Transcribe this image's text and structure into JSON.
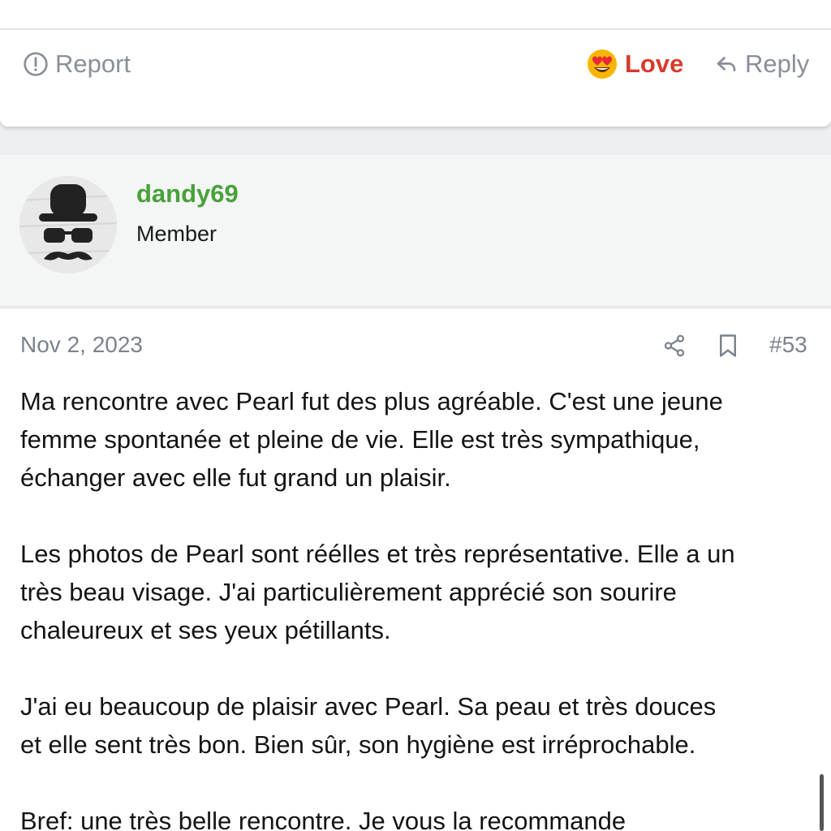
{
  "previous_post": {
    "actions": {
      "report_label": "Report",
      "love_label": "Love",
      "reply_label": "Reply"
    },
    "colors": {
      "love": "#d63b2c",
      "muted": "#8a8f99"
    }
  },
  "post": {
    "author": {
      "username": "dandy69",
      "title": "Member",
      "username_color": "#47a23a"
    },
    "date": "Nov 2, 2023",
    "number": "#53",
    "paragraphs": [
      [
        "Ma rencontre avec Pearl fut des plus agréable. C'est une jeune",
        "femme spontanée et pleine de vie. Elle est très sympathique,",
        "échanger avec elle fut grand un plaisir."
      ],
      [
        "Les photos de Pearl sont réélles et très représentative. Elle a un",
        "très beau visage. J'ai particulièrement apprécié son sourire",
        "chaleureux et ses yeux pétillants."
      ],
      [
        "J'ai eu beaucoup de plaisir avec Pearl. Sa peau et très douces",
        "et elle sent très bon. Bien sûr, son hygiène est irréprochable."
      ],
      [
        "Bref: une très belle rencontre. Je vous la recommande"
      ]
    ]
  },
  "icons": [
    "alert-circle-icon",
    "heart-eyes-emoji-icon",
    "reply-icon",
    "share-icon",
    "bookmark-icon"
  ]
}
